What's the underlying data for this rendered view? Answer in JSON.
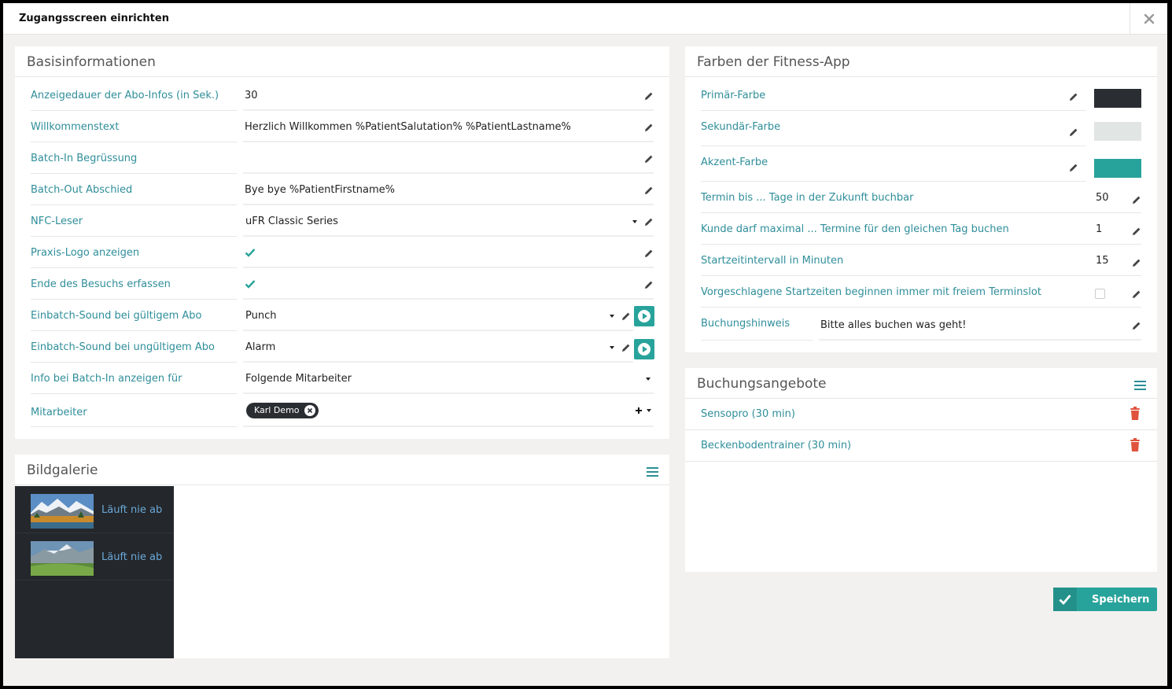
{
  "modal": {
    "title": "Zugangsscreen einrichten"
  },
  "basis": {
    "title": "Basisinformationen",
    "rows": [
      {
        "label": "Anzeigedauer der Abo-Infos (in Sek.)",
        "value": "30"
      },
      {
        "label": "Willkommenstext",
        "value": "Herzlich Willkommen %PatientSalutation% %PatientLastname%"
      },
      {
        "label": "Batch-In Begrüssung",
        "value": ""
      },
      {
        "label": "Batch-Out Abschied",
        "value": "Bye bye %PatientFirstname%"
      },
      {
        "label": "NFC-Leser",
        "value": "uFR Classic Series"
      },
      {
        "label": "Praxis-Logo anzeigen",
        "checked": true
      },
      {
        "label": "Ende des Besuchs erfassen",
        "checked": true
      },
      {
        "label": "Einbatch-Sound bei gültigem Abo",
        "value": "Punch"
      },
      {
        "label": "Einbatch-Sound bei ungültigem Abo",
        "value": "Alarm"
      },
      {
        "label": "Info bei Batch-In anzeigen für",
        "value": "Folgende Mitarbeiter"
      },
      {
        "label": "Mitarbeiter",
        "tag": "Karl Demo"
      }
    ]
  },
  "gallery": {
    "title": "Bildgalerie",
    "items": [
      {
        "label": "Läuft nie ab"
      },
      {
        "label": "Läuft nie ab"
      }
    ]
  },
  "colors": {
    "title": "Farben der Fitness-App",
    "rows": [
      {
        "label": "Primär-Farbe",
        "color": "#2a2e33"
      },
      {
        "label": "Sekundär-Farbe",
        "color": "#e1e5e4"
      },
      {
        "label": "Akzent-Farbe",
        "color": "#28a39b"
      },
      {
        "label": "Termin bis ... Tage in der Zukunft buchbar",
        "value": "50"
      },
      {
        "label": "Kunde darf maximal ... Termine für den gleichen Tag buchen",
        "value": "1"
      },
      {
        "label": "Startzeitintervall in Minuten",
        "value": "15"
      },
      {
        "label": "Vorgeschlagene Startzeiten beginnen immer mit freiem Terminslot",
        "checked": false
      },
      {
        "label": "Buchungshinweis",
        "value": "Bitte alles buchen was geht!"
      }
    ]
  },
  "offers": {
    "title": "Buchungsangebote",
    "items": [
      {
        "label": "Sensopro (30 min)"
      },
      {
        "label": "Beckenbodentrainer (30 min)"
      }
    ]
  },
  "actions": {
    "save_label": "Speichern"
  },
  "theme": {
    "accent": "#28a39b",
    "label_color": "#2f8e9a",
    "delete_color": "#e0533c"
  }
}
